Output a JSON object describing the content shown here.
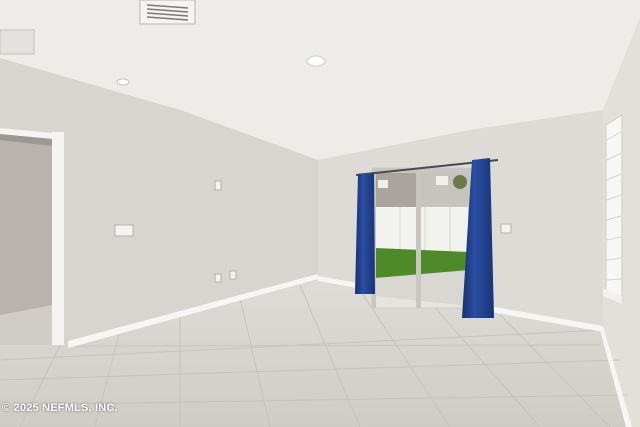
{
  "photo": {
    "subject": "empty-room-with-sliding-glass-door",
    "watermark": "© 2025 NEFMLS, INC.",
    "colors": {
      "ceiling": "#efedea",
      "wall_left": "#d9d5d1",
      "wall_back": "#dcd9d5",
      "wall_right": "#e2dfdb",
      "floor_tile": "#d8d6d1",
      "curtain": "#1f3d8a",
      "lawn": "#4f8a2a",
      "fence": "#f2f2ef"
    }
  }
}
